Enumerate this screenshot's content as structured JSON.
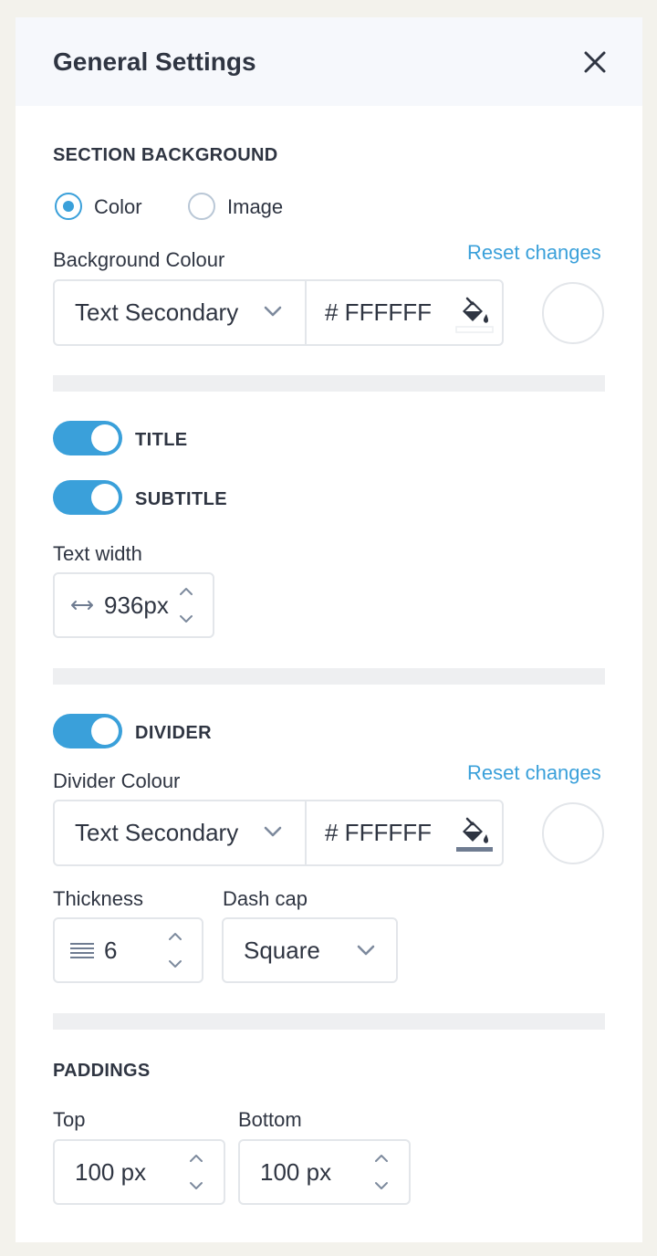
{
  "panel": {
    "title": "General Settings"
  },
  "section_background": {
    "heading": "SECTION BACKGROUND",
    "options": [
      {
        "label": "Color",
        "selected": true
      },
      {
        "label": "Image",
        "selected": false
      }
    ],
    "color_label": "Background Colour",
    "reset_label": "Reset changes",
    "color_select_value": "Text Secondary",
    "hex_value": "# FFFFFF"
  },
  "toggles": {
    "title": {
      "label": "TITLE",
      "on": true
    },
    "subtitle": {
      "label": "SUBTITLE",
      "on": true
    },
    "divider": {
      "label": "DIVIDER",
      "on": true
    }
  },
  "text_width": {
    "label": "Text width",
    "value": "936px"
  },
  "divider": {
    "color_label": "Divider Colour",
    "reset_label": "Reset changes",
    "color_select_value": "Text Secondary",
    "hex_value": "# FFFFFF",
    "thickness_label": "Thickness",
    "thickness_value": "6",
    "dash_cap_label": "Dash cap",
    "dash_cap_value": "Square"
  },
  "paddings": {
    "heading": "PADDINGS",
    "top_label": "Top",
    "top_value": "100 px",
    "bottom_label": "Bottom",
    "bottom_value": "100 px"
  },
  "colors": {
    "accent": "#3aa0da",
    "text": "#2f3542",
    "border": "#e3e6ea",
    "header_bg": "#f6f8fc",
    "page_bg": "#f3f2ec",
    "fill_underline": "#6f7c91"
  }
}
